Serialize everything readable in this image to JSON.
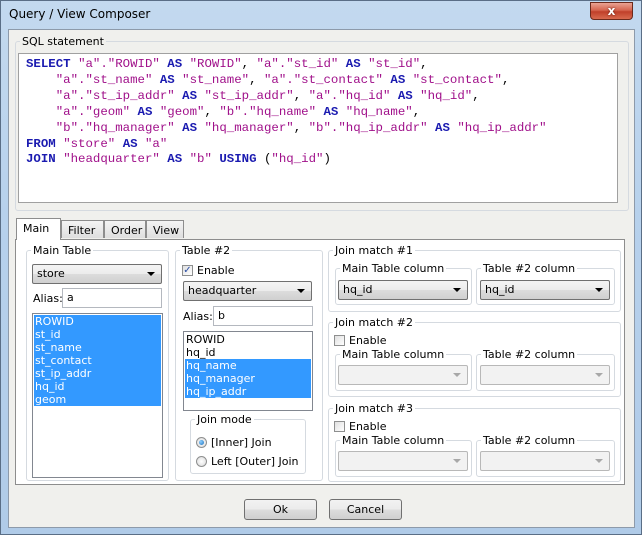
{
  "window": {
    "title": "Query / View Composer",
    "close_glyph": "x"
  },
  "sql": {
    "label": "SQL statement",
    "lines": [
      [
        [
          "kw",
          "SELECT"
        ],
        [
          "t",
          " "
        ],
        [
          "str",
          "\"a\".\"ROWID\""
        ],
        [
          "t",
          " "
        ],
        [
          "kw",
          "AS"
        ],
        [
          "t",
          " "
        ],
        [
          "str",
          "\"ROWID\""
        ],
        [
          "t",
          ", "
        ],
        [
          "str",
          "\"a\".\"st_id\""
        ],
        [
          "t",
          " "
        ],
        [
          "kw",
          "AS"
        ],
        [
          "t",
          " "
        ],
        [
          "str",
          "\"st_id\""
        ],
        [
          "t",
          ","
        ]
      ],
      [
        [
          "t",
          "    "
        ],
        [
          "str",
          "\"a\".\"st_name\""
        ],
        [
          "t",
          " "
        ],
        [
          "kw",
          "AS"
        ],
        [
          "t",
          " "
        ],
        [
          "str",
          "\"st_name\""
        ],
        [
          "t",
          ", "
        ],
        [
          "str",
          "\"a\".\"st_contact\""
        ],
        [
          "t",
          " "
        ],
        [
          "kw",
          "AS"
        ],
        [
          "t",
          " "
        ],
        [
          "str",
          "\"st_contact\""
        ],
        [
          "t",
          ","
        ]
      ],
      [
        [
          "t",
          "    "
        ],
        [
          "str",
          "\"a\".\"st_ip_addr\""
        ],
        [
          "t",
          " "
        ],
        [
          "kw",
          "AS"
        ],
        [
          "t",
          " "
        ],
        [
          "str",
          "\"st_ip_addr\""
        ],
        [
          "t",
          ", "
        ],
        [
          "str",
          "\"a\".\"hq_id\""
        ],
        [
          "t",
          " "
        ],
        [
          "kw",
          "AS"
        ],
        [
          "t",
          " "
        ],
        [
          "str",
          "\"hq_id\""
        ],
        [
          "t",
          ","
        ]
      ],
      [
        [
          "t",
          "    "
        ],
        [
          "str",
          "\"a\".\"geom\""
        ],
        [
          "t",
          " "
        ],
        [
          "kw",
          "AS"
        ],
        [
          "t",
          " "
        ],
        [
          "str",
          "\"geom\""
        ],
        [
          "t",
          ", "
        ],
        [
          "str",
          "\"b\".\"hq_name\""
        ],
        [
          "t",
          " "
        ],
        [
          "kw",
          "AS"
        ],
        [
          "t",
          " "
        ],
        [
          "str",
          "\"hq_name\""
        ],
        [
          "t",
          ","
        ]
      ],
      [
        [
          "t",
          "    "
        ],
        [
          "str",
          "\"b\".\"hq_manager\""
        ],
        [
          "t",
          " "
        ],
        [
          "kw",
          "AS"
        ],
        [
          "t",
          " "
        ],
        [
          "str",
          "\"hq_manager\""
        ],
        [
          "t",
          ", "
        ],
        [
          "str",
          "\"b\".\"hq_ip_addr\""
        ],
        [
          "t",
          " "
        ],
        [
          "kw",
          "AS"
        ],
        [
          "t",
          " "
        ],
        [
          "str",
          "\"hq_ip_addr\""
        ]
      ],
      [
        [
          "kw",
          "FROM"
        ],
        [
          "t",
          " "
        ],
        [
          "str",
          "\"store\""
        ],
        [
          "t",
          " "
        ],
        [
          "kw",
          "AS"
        ],
        [
          "t",
          " "
        ],
        [
          "str",
          "\"a\""
        ]
      ],
      [
        [
          "kw",
          "JOIN"
        ],
        [
          "t",
          " "
        ],
        [
          "str",
          "\"headquarter\""
        ],
        [
          "t",
          " "
        ],
        [
          "kw",
          "AS"
        ],
        [
          "t",
          " "
        ],
        [
          "str",
          "\"b\""
        ],
        [
          "t",
          " "
        ],
        [
          "kw",
          "USING"
        ],
        [
          "t",
          " ("
        ],
        [
          "str",
          "\"hq_id\""
        ],
        [
          "t",
          ")"
        ]
      ]
    ]
  },
  "tabs": [
    {
      "label": "Main",
      "active": true
    },
    {
      "label": "Filter",
      "active": false
    },
    {
      "label": "Order",
      "active": false
    },
    {
      "label": "View",
      "active": false
    }
  ],
  "main_table": {
    "label": "Main Table",
    "selected": "store",
    "alias_label": "Alias:",
    "alias": "a",
    "columns": [
      {
        "name": "ROWID",
        "selected": true
      },
      {
        "name": "st_id",
        "selected": true
      },
      {
        "name": "st_name",
        "selected": true
      },
      {
        "name": "st_contact",
        "selected": true
      },
      {
        "name": "st_ip_addr",
        "selected": true
      },
      {
        "name": "hq_id",
        "selected": true
      },
      {
        "name": "geom",
        "selected": true
      }
    ]
  },
  "table2": {
    "label": "Table #2",
    "enable_label": "Enable",
    "enabled": true,
    "selected": "headquarter",
    "alias_label": "Alias:",
    "alias": "b",
    "columns": [
      {
        "name": "ROWID",
        "selected": false
      },
      {
        "name": "hq_id",
        "selected": false
      },
      {
        "name": "hq_name",
        "selected": true
      },
      {
        "name": "hq_manager",
        "selected": true
      },
      {
        "name": "hq_ip_addr",
        "selected": true
      }
    ],
    "join_mode": {
      "label": "Join mode",
      "options": [
        {
          "label": "[Inner] Join",
          "checked": true
        },
        {
          "label": "Left [Outer] Join",
          "checked": false
        }
      ]
    }
  },
  "join_matches": [
    {
      "label": "Join match #1",
      "has_enable": false,
      "main_col_label": "Main Table column",
      "main_col": "hq_id",
      "t2_col_label": "Table #2 column",
      "t2_col": "hq_id"
    },
    {
      "label": "Join match #2",
      "has_enable": true,
      "enable_label": "Enable",
      "enabled": false,
      "main_col_label": "Main Table column",
      "main_col": "",
      "t2_col_label": "Table #2 column",
      "t2_col": ""
    },
    {
      "label": "Join match #3",
      "has_enable": true,
      "enable_label": "Enable",
      "enabled": false,
      "main_col_label": "Main Table column",
      "main_col": "",
      "t2_col_label": "Table #2 column",
      "t2_col": ""
    }
  ],
  "buttons": {
    "ok": "Ok",
    "cancel": "Cancel"
  },
  "colors": {
    "sql_keyword": "#1a1ab0",
    "sql_string": "#a0108a",
    "selection": "#3399ff"
  }
}
